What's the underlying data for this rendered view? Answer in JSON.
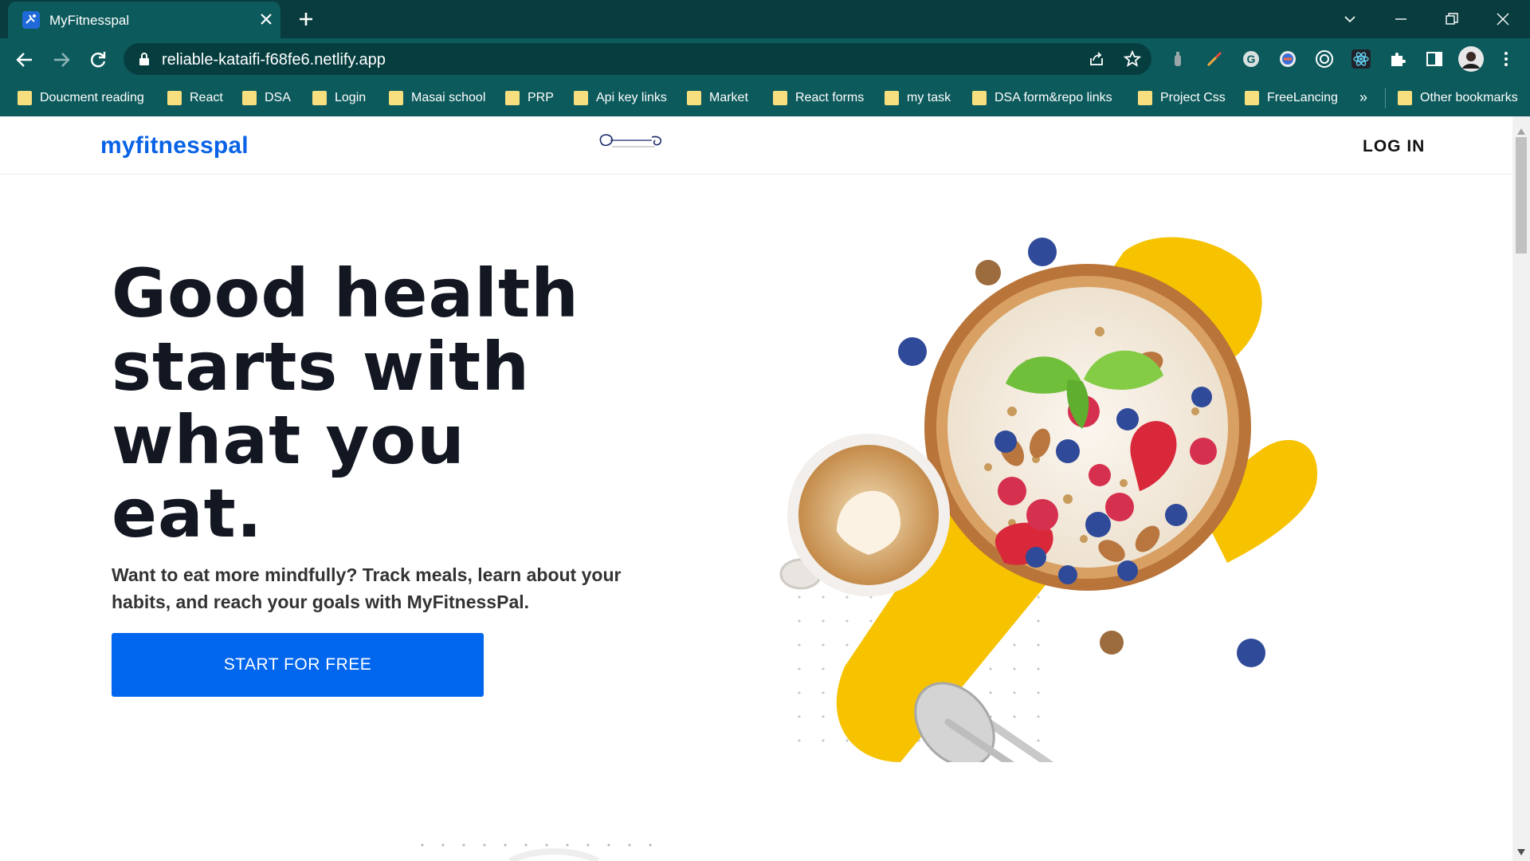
{
  "browser": {
    "tab": {
      "title": "MyFitnesspal",
      "favicon": "myfitnesspal-icon"
    },
    "url": "reliable-kataifi-f68fe6.netlify.app",
    "bookmarks": [
      "Doucment reading",
      "React",
      "DSA",
      "Login",
      "Masai school",
      "PRP",
      "Api key links",
      "Market",
      "React forms",
      "my task",
      "DSA  form&repo links",
      "Project Css",
      "FreeLancing"
    ],
    "bookmarks_more": "»",
    "other_bookmarks": "Other bookmarks",
    "colors": {
      "frame": "#083c3e",
      "toolbar": "#0d5a5c"
    }
  },
  "site": {
    "brand": "myfitnesspal",
    "login_label": "LOG IN",
    "hero": {
      "title_lines": [
        "Good health",
        "starts with",
        "what you",
        "eat."
      ],
      "subtitle": "Want to eat more mindfully? Track meals, learn about your habits, and reach your goals with MyFitnessPal.",
      "cta_label": "START FOR FREE"
    },
    "colors": {
      "brand": "#0a63e6",
      "cta": "#0066ee",
      "accent_yellow": "#f7c200"
    }
  }
}
